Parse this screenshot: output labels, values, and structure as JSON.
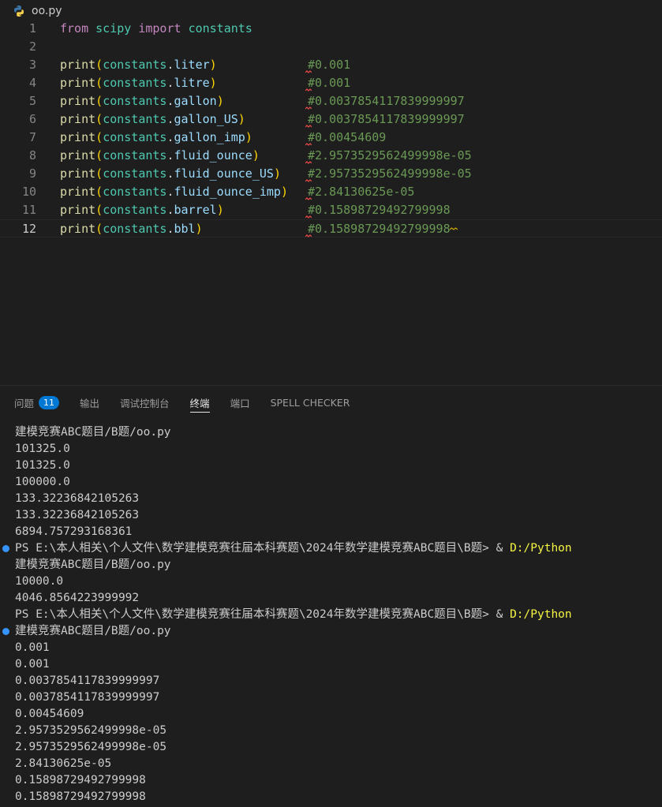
{
  "editor": {
    "file_name": "oo.py",
    "lines": [
      {
        "n": "1",
        "tokens": [
          {
            "t": "from",
            "c": "kw"
          },
          {
            "t": " ",
            "c": "txt"
          },
          {
            "t": "scipy",
            "c": "mod"
          },
          {
            "t": " ",
            "c": "txt"
          },
          {
            "t": "import",
            "c": "kw"
          },
          {
            "t": " ",
            "c": "txt"
          },
          {
            "t": "constants",
            "c": "mod"
          }
        ],
        "comment": ""
      },
      {
        "n": "2",
        "tokens": [],
        "comment": ""
      },
      {
        "n": "3",
        "tokens": [
          {
            "t": "print",
            "c": "fn"
          },
          {
            "t": "(",
            "c": "p1"
          },
          {
            "t": "constants",
            "c": "mod"
          },
          {
            "t": ".",
            "c": "txt"
          },
          {
            "t": "liter",
            "c": "var"
          },
          {
            "t": ")",
            "c": "p1"
          }
        ],
        "comment": "#0.001"
      },
      {
        "n": "4",
        "tokens": [
          {
            "t": "print",
            "c": "fn"
          },
          {
            "t": "(",
            "c": "p1"
          },
          {
            "t": "constants",
            "c": "mod"
          },
          {
            "t": ".",
            "c": "txt"
          },
          {
            "t": "litre",
            "c": "var"
          },
          {
            "t": ")",
            "c": "p1"
          }
        ],
        "comment": "#0.001"
      },
      {
        "n": "5",
        "tokens": [
          {
            "t": "print",
            "c": "fn"
          },
          {
            "t": "(",
            "c": "p1"
          },
          {
            "t": "constants",
            "c": "mod"
          },
          {
            "t": ".",
            "c": "txt"
          },
          {
            "t": "gallon",
            "c": "var"
          },
          {
            "t": ")",
            "c": "p1"
          }
        ],
        "comment": "#0.0037854117839999997"
      },
      {
        "n": "6",
        "tokens": [
          {
            "t": "print",
            "c": "fn"
          },
          {
            "t": "(",
            "c": "p1"
          },
          {
            "t": "constants",
            "c": "mod"
          },
          {
            "t": ".",
            "c": "txt"
          },
          {
            "t": "gallon_US",
            "c": "var"
          },
          {
            "t": ")",
            "c": "p1"
          }
        ],
        "comment": "#0.0037854117839999997"
      },
      {
        "n": "7",
        "tokens": [
          {
            "t": "print",
            "c": "fn"
          },
          {
            "t": "(",
            "c": "p1"
          },
          {
            "t": "constants",
            "c": "mod"
          },
          {
            "t": ".",
            "c": "txt"
          },
          {
            "t": "gallon_imp",
            "c": "var"
          },
          {
            "t": ")",
            "c": "p1"
          }
        ],
        "comment": "#0.00454609"
      },
      {
        "n": "8",
        "tokens": [
          {
            "t": "print",
            "c": "fn"
          },
          {
            "t": "(",
            "c": "p1"
          },
          {
            "t": "constants",
            "c": "mod"
          },
          {
            "t": ".",
            "c": "txt"
          },
          {
            "t": "fluid_ounce",
            "c": "var"
          },
          {
            "t": ")",
            "c": "p1"
          }
        ],
        "comment": "#2.9573529562499998e-05"
      },
      {
        "n": "9",
        "tokens": [
          {
            "t": "print",
            "c": "fn"
          },
          {
            "t": "(",
            "c": "p1"
          },
          {
            "t": "constants",
            "c": "mod"
          },
          {
            "t": ".",
            "c": "txt"
          },
          {
            "t": "fluid_ounce_US",
            "c": "var"
          },
          {
            "t": ")",
            "c": "p1"
          }
        ],
        "comment": "#2.9573529562499998e-05"
      },
      {
        "n": "10",
        "tokens": [
          {
            "t": "print",
            "c": "fn"
          },
          {
            "t": "(",
            "c": "p1"
          },
          {
            "t": "constants",
            "c": "mod"
          },
          {
            "t": ".",
            "c": "txt"
          },
          {
            "t": "fluid_ounce_imp",
            "c": "var"
          },
          {
            "t": ")",
            "c": "p1"
          }
        ],
        "comment": "#2.84130625e-05"
      },
      {
        "n": "11",
        "tokens": [
          {
            "t": "print",
            "c": "fn"
          },
          {
            "t": "(",
            "c": "p1"
          },
          {
            "t": "constants",
            "c": "mod"
          },
          {
            "t": ".",
            "c": "txt"
          },
          {
            "t": "barrel",
            "c": "var"
          },
          {
            "t": ")",
            "c": "p1"
          }
        ],
        "comment": "#0.15898729492799998"
      },
      {
        "n": "12",
        "tokens": [
          {
            "t": "print",
            "c": "fn"
          },
          {
            "t": "(",
            "c": "p1"
          },
          {
            "t": "constants",
            "c": "mod"
          },
          {
            "t": ".",
            "c": "txt"
          },
          {
            "t": "bbl",
            "c": "var"
          },
          {
            "t": ")",
            "c": "p1"
          }
        ],
        "comment": "#0.15898729492799998"
      }
    ]
  },
  "panel": {
    "tabs": [
      {
        "label": "问题",
        "badge": "11",
        "active": false,
        "name": "tab-problems"
      },
      {
        "label": "输出",
        "badge": "",
        "active": false,
        "name": "tab-output"
      },
      {
        "label": "调试控制台",
        "badge": "",
        "active": false,
        "name": "tab-debug-console"
      },
      {
        "label": "终端",
        "badge": "",
        "active": true,
        "name": "tab-terminal"
      },
      {
        "label": "端口",
        "badge": "",
        "active": false,
        "name": "tab-ports"
      },
      {
        "label": "SPELL CHECKER",
        "badge": "",
        "active": false,
        "name": "tab-spell-checker"
      }
    ]
  },
  "terminal": {
    "lines": [
      {
        "text": "建模竞赛ABC题目/B题/oo.py",
        "dot": false,
        "prompt": false
      },
      {
        "text": "101325.0",
        "dot": false,
        "prompt": false
      },
      {
        "text": "101325.0",
        "dot": false,
        "prompt": false
      },
      {
        "text": "100000.0",
        "dot": false,
        "prompt": false
      },
      {
        "text": "133.32236842105263",
        "dot": false,
        "prompt": false
      },
      {
        "text": "133.32236842105263",
        "dot": false,
        "prompt": false
      },
      {
        "text": "6894.757293168361",
        "dot": false,
        "prompt": false
      },
      {
        "text": "PS E:\\本人相关\\个人文件\\数学建模竞赛往届本科赛题\\2024年数学建模竞赛ABC题目\\B题> & ",
        "cmd": "D:/Python",
        "dot": true,
        "prompt": true
      },
      {
        "text": "建模竞赛ABC题目/B题/oo.py",
        "dot": false,
        "prompt": false
      },
      {
        "text": "10000.0",
        "dot": false,
        "prompt": false
      },
      {
        "text": "4046.8564223999992",
        "dot": false,
        "prompt": false
      },
      {
        "text": "PS E:\\本人相关\\个人文件\\数学建模竞赛往届本科赛题\\2024年数学建模竞赛ABC题目\\B题> & ",
        "cmd": "D:/Python",
        "dot": false,
        "prompt": true
      },
      {
        "text": "建模竞赛ABC题目/B题/oo.py",
        "dot": true,
        "prompt": false
      },
      {
        "text": "0.001",
        "dot": false,
        "prompt": false
      },
      {
        "text": "0.001",
        "dot": false,
        "prompt": false
      },
      {
        "text": "0.0037854117839999997",
        "dot": false,
        "prompt": false
      },
      {
        "text": "0.0037854117839999997",
        "dot": false,
        "prompt": false
      },
      {
        "text": "0.00454609",
        "dot": false,
        "prompt": false
      },
      {
        "text": "2.9573529562499998e-05",
        "dot": false,
        "prompt": false
      },
      {
        "text": "2.9573529562499998e-05",
        "dot": false,
        "prompt": false
      },
      {
        "text": "2.84130625e-05",
        "dot": false,
        "prompt": false
      },
      {
        "text": "0.15898729492799998",
        "dot": false,
        "prompt": false
      },
      {
        "text": "0.15898729492799998",
        "dot": false,
        "prompt": false
      }
    ]
  },
  "colors": {
    "background": "#1e1e1e",
    "keyword": "#c586c0",
    "function": "#dcdcaa",
    "module": "#4ec9b0",
    "variable": "#9cdcfe",
    "bracket": "#ffd700",
    "comment": "#6a9955",
    "badge": "#0078d4",
    "prompt_dot": "#3794ff",
    "command": "#f5f543"
  }
}
